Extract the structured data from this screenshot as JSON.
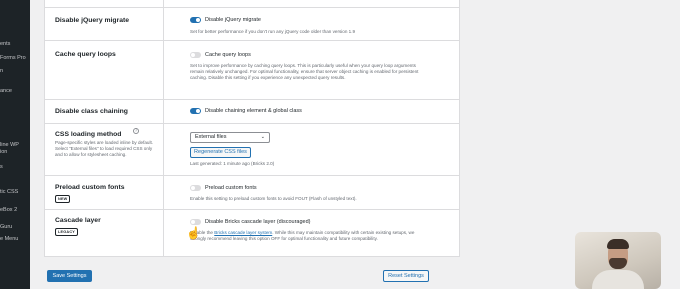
{
  "sidebar": {
    "items": [
      "ents",
      "Forms Pro",
      "n",
      "ance",
      "line WP",
      "ion",
      "s",
      "tic CSS",
      "eBox 2",
      "Guru",
      "e Menu"
    ]
  },
  "settings": {
    "rows": [
      {
        "title": "Disable jQuery migrate",
        "toggle_on": true,
        "toggle_label": "Disable jQuery migrate",
        "field_desc": "Set for better performance if you don't run any jQuery code older than version 1.9"
      },
      {
        "title": "Cache query loops",
        "toggle_on": false,
        "toggle_label": "Cache query loops",
        "field_desc": "Set to improve performance by caching query loops. This is particularly useful when your query loop arguments remain relatively unchanged. For optimal functionality, ensure that server object caching is enabled for persistent caching. Disable this setting if you experience any unexpected query results."
      },
      {
        "title": "Disable class chaining",
        "toggle_on": true,
        "toggle_label": "Disable chaining element & global class"
      },
      {
        "title": "CSS loading method",
        "help_icon": "?",
        "label_desc": "Page-specific styles are loaded inline by default. Select \"External files\" to load required CSS only and to allow for stylesheet caching.",
        "select_value": "External files",
        "regenerate_label": "Regenerate CSS files",
        "last_generated": "Last generated: 1 minute ago (Bricks 2.0)"
      },
      {
        "title": "Preload custom fonts",
        "badge": "NEW",
        "toggle_on": false,
        "toggle_label": "Preload custom fonts",
        "field_desc": "Enable this setting to preload custom fonts to avoid FOUT (Flash of unstyled text)."
      },
      {
        "title": "Cascade layer",
        "badge": "LEGACY",
        "toggle_on": false,
        "toggle_label": "Disable Bricks cascade layer (discouraged)",
        "desc_start": "Disable the",
        "desc_link": "Bricks cascade layer system",
        "desc_rest": ". While this may maintain compatibility with certain existing setups, we strongly recommend leaving this option OFF for optimal functionality and future compatibility."
      }
    ]
  },
  "footer": {
    "save_label": "Save Settings",
    "reset_label": "Reset Settings"
  },
  "colors": {
    "accent": "#2271b1",
    "sidebar_bg": "#1d2327",
    "page_bg": "#f0f0f1"
  },
  "icons": {
    "help": "help-icon",
    "select_chevron": "chevron-down-icon",
    "cursor": "pointer-hand-icon"
  }
}
